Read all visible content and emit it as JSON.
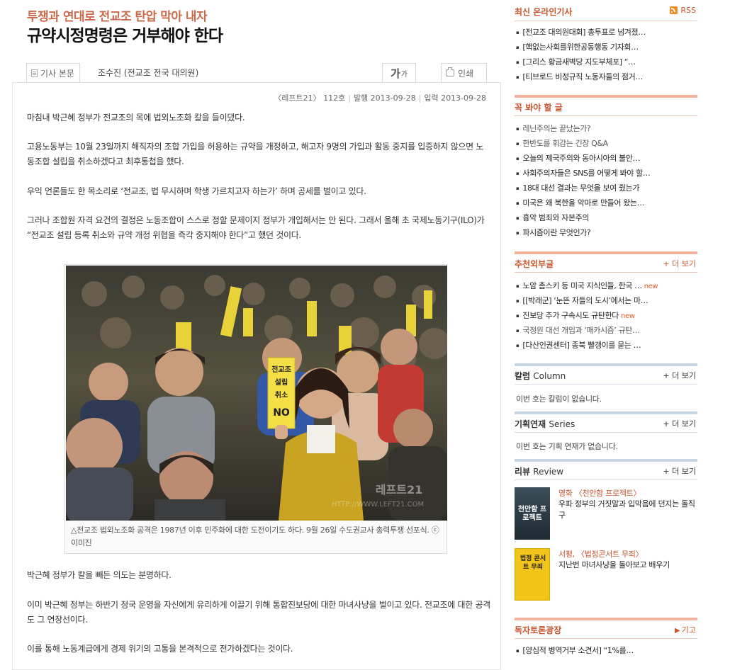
{
  "article": {
    "subtitle": "투쟁과 연대로 전교조 탄압 막아 내자",
    "title": "규약시정명령은 거부해야 한다",
    "tab_article": "기사 본문",
    "author": "조수진 (전교조 전국 대의원)",
    "font_tab_large": "가",
    "font_tab_small": "가",
    "print_label": "인쇄",
    "meta": {
      "issue": "〈레프트21〉 112호",
      "published": "발행 2013-09-28",
      "entered": "입력 2013-09-28"
    },
    "paragraphs": [
      "마침내 박근혜 정부가 전교조의 목에 법외노조화 칼을 들이댔다.",
      "고용노동부는 10월 23일까지 해직자의 조합 가입을 허용하는 규약을 개정하고, 해고자 9명의 가입과 활동 중지를 입증하지 않으면 노동조합 설립을 취소하겠다고 최후통첩을 했다.",
      "우익 언론들도 한 목소리로 ‘전교조, 법 무시하며 학생 가르치고자 하는가’ 하며 공세를 벌이고 있다.",
      "그러나 조합원 자격 요건의 결정은 노동조합이 스스로 정할 문제이지 정부가 개입해서는 안 된다. 그래서 올해 초 국제노동기구(ILO)가 “전교조 설립 등록 취소와 규약 개정 위협을 즉각 중지해야 한다”고 했던 것이다.",
      "박근혜 정부가 칼을 빼든 의도는 분명하다.",
      "이미 박근혜 정부는 하반기 정국 운영을 자신에게 유리하게 이끌기 위해 통합진보당에 대한 마녀사냥을 벌이고 있다. 전교조에 대한 공격도 그 연장선이다.",
      "이를 통해 노동계급에게 경제 위기의 고통을 본격적으로 전가하겠다는 것이다."
    ],
    "photo": {
      "placard_lines": [
        "전교조",
        "설립",
        "취소",
        "NO"
      ],
      "watermark": "레프트21",
      "watermark_url": "HTTP://WWW.LEFT21.COM",
      "caption": "△전교조 법외노조화 공격은 1987년 이후 민주화에 대한 도전이기도 하다. 9월 26일 수도권교사 총력투쟁 선포식. ⓒ이미진"
    }
  },
  "sidebar": {
    "latest": {
      "heading": "최신 온라인기사",
      "rss_label": "RSS",
      "items": [
        "[전교조 대의원대회] 총투표로 넘겨졌…",
        "[핵없는사회를위한공동행동 기자회…",
        "[그리스 황금새벽당 지도부체포] “…",
        "[티브로드 비정규직 노동자들의 점거…"
      ]
    },
    "must_read": {
      "heading": "꼭 봐야 할 글",
      "items": [
        "레닌주의는 끝났는가?",
        "한반도를 휘감는 긴장 Q&A",
        "오늘의 제국주의와 동아시아의 불안…",
        "사회주의자들은 SNS를 어떻게 봐야 할…",
        "18대 대선 결과는 무엇을 보여 줬는가",
        "미국은 왜 북한을 악마로 만들어 왔는…",
        "흉악 범죄와 자본주의",
        "파시즘이란 무엇인가?"
      ]
    },
    "recommended": {
      "heading": "추천외부글",
      "more": "+ 더 보기",
      "items": [
        {
          "text": "노암 촘스키 등 미국 지식인들, 한국 …",
          "new": "new"
        },
        {
          "text": "[[박래군] ‘눈뜬 자들의 도시’에서는 마…",
          "new": ""
        },
        {
          "text": "진보당 추가 구속시도 규탄한다",
          "new": "new"
        },
        {
          "text": "국정원 대선 개입과 ‘매카시즘’ 규탄…",
          "new": ""
        },
        {
          "text": "[다산인권센터] 종북 빨갱이를 묻는 …",
          "new": ""
        }
      ]
    },
    "column": {
      "heading": "칼럼",
      "heading_en": "Column",
      "more": "+ 더 보기",
      "empty": "이번 호는 칼럼이 없습니다."
    },
    "series": {
      "heading": "기획연재",
      "heading_en": "Series",
      "more": "+ 더 보기",
      "empty": "이번 호는 기획 연재가 없습니다."
    },
    "review": {
      "heading": "리뷰",
      "heading_en": "Review",
      "more": "+ 더 보기",
      "items": [
        {
          "title": "영화 〈천안함 프로젝트〉",
          "desc": "우파 정부의 거짓말과 입막음에 던지는 돌직구",
          "cover_text": "천안함 프로젝트"
        },
        {
          "title": "서평, 〈법정콘서트 무죄〉",
          "desc": "지난번 마녀사냥을 돌아보고 배우기",
          "cover_text": "법정 콘서트 무죄"
        }
      ]
    },
    "forum": {
      "heading": "독자토론광장",
      "more": "기고",
      "items": [
        "[양심적 병역거부 소견서] “1%를…"
      ]
    }
  },
  "colors": {
    "accent": "#c8552e",
    "subtitle": "#c86a4b",
    "orange_bar": "#f1b39b",
    "blue_bar": "#c8d7e6"
  }
}
